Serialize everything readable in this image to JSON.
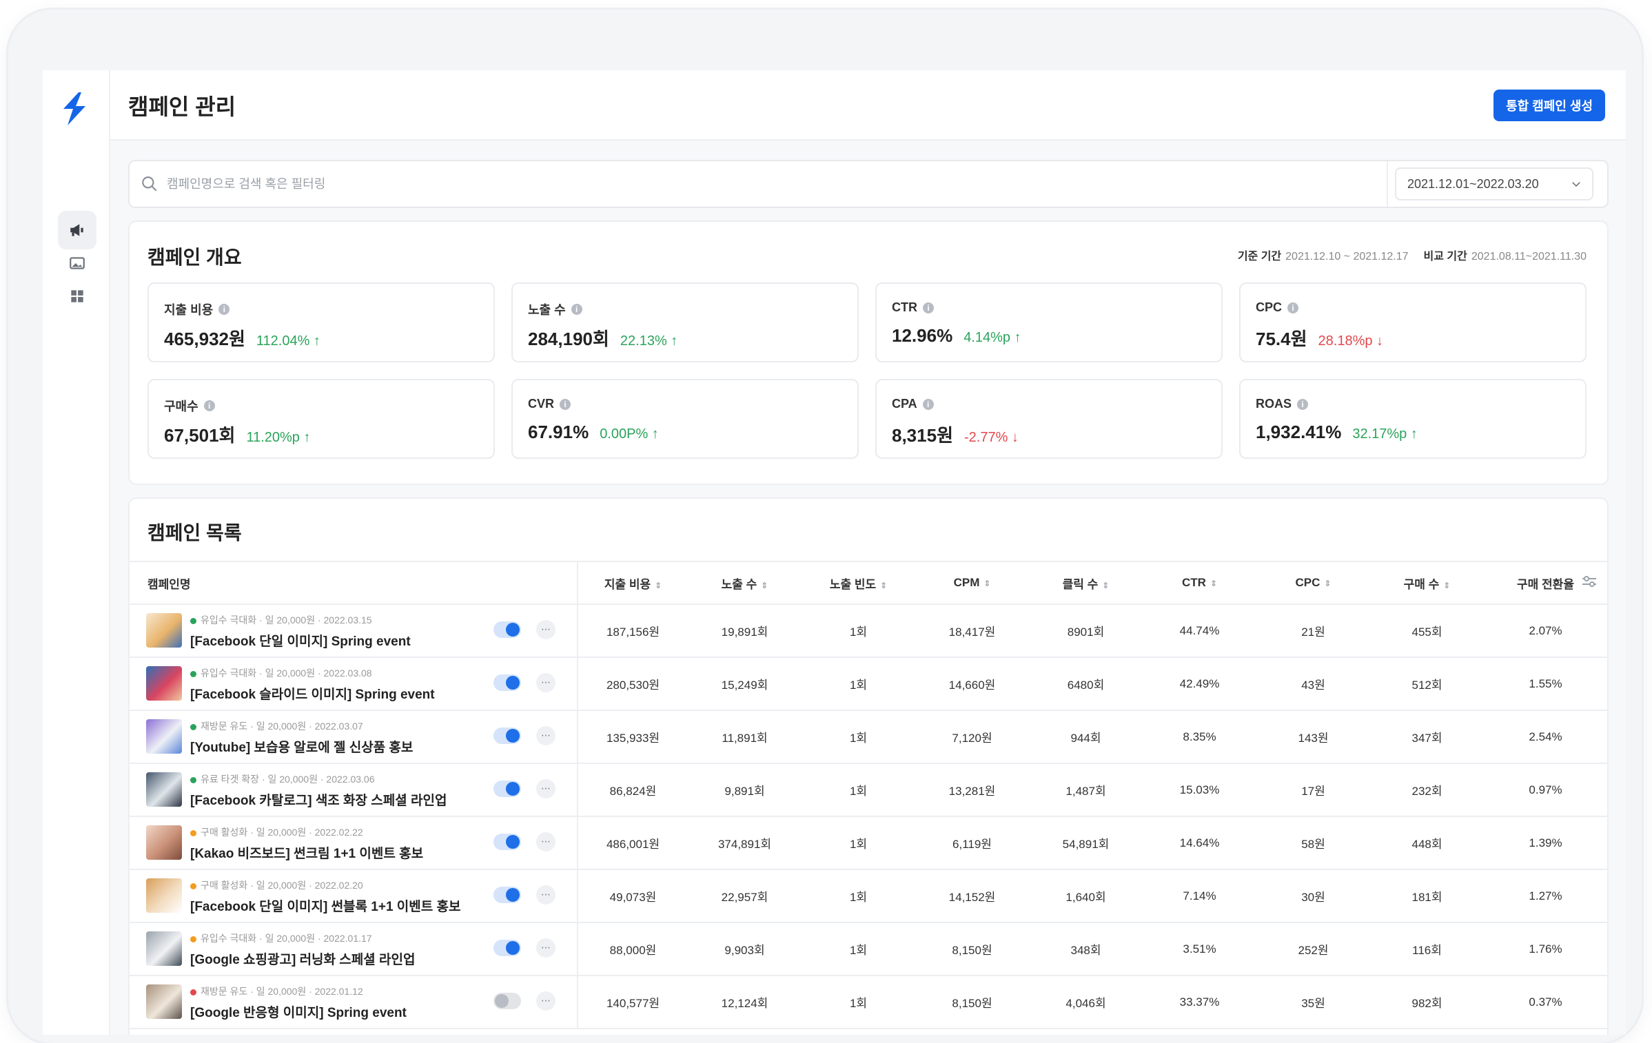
{
  "header": {
    "title": "캠페인 관리",
    "create_button": "통합 캠페인 생성"
  },
  "sidebar": {
    "icons": [
      "megaphone-icon",
      "image-icon",
      "grid-icon"
    ],
    "active": 0
  },
  "search": {
    "placeholder": "캠페인명으로 검색 혹은 필터링",
    "date_range": "2021.12.01~2022.03.20"
  },
  "overview": {
    "title": "캠페인 개요",
    "base_label": "기준 기간",
    "base_period": "2021.12.10 ~ 2021.12.17",
    "compare_label": "비교 기간",
    "compare_period": "2021.08.11~2021.11.30",
    "metrics": [
      {
        "label": "지출 비용",
        "value": "465,932원",
        "change": "112.04% ↑",
        "dir": "up"
      },
      {
        "label": "노출 수",
        "value": "284,190회",
        "change": "22.13% ↑",
        "dir": "up"
      },
      {
        "label": "CTR",
        "value": "12.96%",
        "change": "4.14%p ↑",
        "dir": "up"
      },
      {
        "label": "CPC",
        "value": "75.4원",
        "change": "28.18%p ↓",
        "dir": "down"
      },
      {
        "label": "구매수",
        "value": "67,501회",
        "change": "11.20%p ↑",
        "dir": "up"
      },
      {
        "label": "CVR",
        "value": "67.91%",
        "change": "0.00P% ↑",
        "dir": "up"
      },
      {
        "label": "CPA",
        "value": "8,315원",
        "change": "-2.77% ↓",
        "dir": "down"
      },
      {
        "label": "ROAS",
        "value": "1,932.41%",
        "change": "32.17%p ↑",
        "dir": "up"
      }
    ]
  },
  "list": {
    "title": "캠페인 목록",
    "columns": [
      "캠페인명",
      "지출 비용",
      "노출 수",
      "노출 빈도",
      "CPM",
      "클릭 수",
      "CTR",
      "CPC",
      "구매 수",
      "구매 전환율"
    ],
    "rows": [
      {
        "meta": "유입수 극대화 · 일 20,000원 · 2022.03.15",
        "dot": "#2aa35a",
        "name": "[Facebook 단일 이미지] Spring event",
        "on": true,
        "cells": [
          "187,156원",
          "19,891회",
          "1회",
          "18,417원",
          "8901회",
          "44.74%",
          "21원",
          "455회",
          "2.07%"
        ]
      },
      {
        "meta": "유입수 극대화 · 일 20,000원 · 2022.03.08",
        "dot": "#2aa35a",
        "name": "[Facebook 슬라이드 이미지] Spring event",
        "on": true,
        "cells": [
          "280,530원",
          "15,249회",
          "1회",
          "14,660원",
          "6480회",
          "42.49%",
          "43원",
          "512회",
          "1.55%"
        ]
      },
      {
        "meta": "재방문 유도 · 일 20,000원 · 2022.03.07",
        "dot": "#2aa35a",
        "name": "[Youtube] 보습용 알로에 젤 신상품 홍보",
        "on": true,
        "cells": [
          "135,933원",
          "11,891회",
          "1회",
          "7,120원",
          "944회",
          "8.35%",
          "143원",
          "347회",
          "2.54%"
        ]
      },
      {
        "meta": "유료 타겟 확장 · 일 20,000원 · 2022.03.06",
        "dot": "#2aa35a",
        "name": "[Facebook 카탈로그] 색조 화장 스페셜 라인업",
        "on": true,
        "cells": [
          "86,824원",
          "9,891회",
          "1회",
          "13,281원",
          "1,487회",
          "15.03%",
          "17원",
          "232회",
          "0.97%"
        ]
      },
      {
        "meta": "구매 활성화 · 일 20,000원 · 2022.02.22",
        "dot": "#f39c1f",
        "name": "[Kakao 비즈보드] 썬크림 1+1 이벤트 홍보",
        "on": true,
        "cells": [
          "486,001원",
          "374,891회",
          "1회",
          "6,119원",
          "54,891회",
          "14.64%",
          "58원",
          "448회",
          "1.39%"
        ]
      },
      {
        "meta": "구매 활성화 · 일 20,000원 · 2022.02.20",
        "dot": "#f39c1f",
        "name": "[Facebook 단일 이미지] 썬블록 1+1 이벤트 홍보",
        "on": true,
        "cells": [
          "49,073원",
          "22,957회",
          "1회",
          "14,152원",
          "1,640회",
          "7.14%",
          "30원",
          "181회",
          "1.27%"
        ]
      },
      {
        "meta": "유입수 극대화 · 일 20,000원 · 2022.01.17",
        "dot": "#f39c1f",
        "name": "[Google 쇼핑광고] 러닝화 스페셜 라인업",
        "on": true,
        "cells": [
          "88,000원",
          "9,903회",
          "1회",
          "8,150원",
          "348회",
          "3.51%",
          "252원",
          "116회",
          "1.76%"
        ]
      },
      {
        "meta": "재방문 유도 · 일 20,000원 · 2022.01.12",
        "dot": "#e3474d",
        "name": "[Google 반응형 이미지] Spring event",
        "on": false,
        "cells": [
          "140,577원",
          "12,124회",
          "1회",
          "8,150원",
          "4,046회",
          "33.37%",
          "35원",
          "982회",
          "0.37%"
        ]
      }
    ]
  },
  "colors": {
    "accent": "#1565e8",
    "up": "#2aa35a",
    "down": "#e3474d"
  }
}
